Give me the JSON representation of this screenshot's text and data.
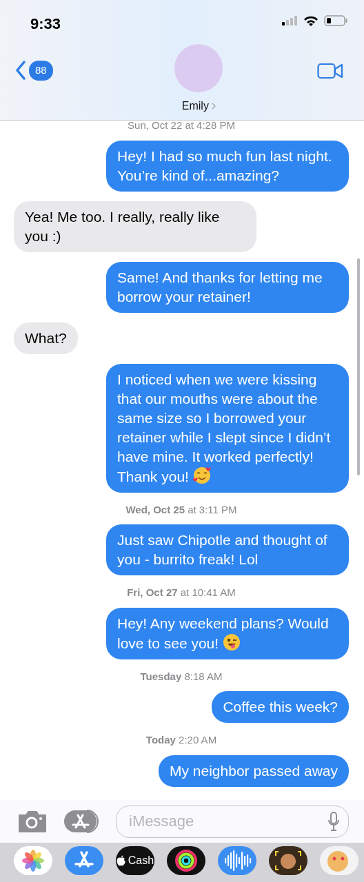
{
  "status_bar": {
    "time": "9:33"
  },
  "header": {
    "back_badge": "88",
    "contact_name": "Emily"
  },
  "messages": [
    {
      "kind": "timestamp",
      "text": "Sun, Oct 22 at 4:28 PM"
    },
    {
      "kind": "sent",
      "text": "Hey! I had so much fun last night. You’re kind of...amazing?"
    },
    {
      "kind": "received",
      "text": "Yea! Me too. I really, really like you :)"
    },
    {
      "kind": "sent",
      "text": "Same! And thanks for letting me borrow your retainer!"
    },
    {
      "kind": "received",
      "text": "What?"
    },
    {
      "kind": "sent",
      "text": "I noticed when we were kissing that our mouths were about the same size so I borrowed your retainer while I slept since I didn’t have mine. It worked perfectly! Thank you!",
      "emoji": {
        "kind": "hearts"
      }
    },
    {
      "kind": "timestamp",
      "text": "**Wed, Oct 25** at 3:11 PM"
    },
    {
      "kind": "sent",
      "text": "Just saw Chipotle and thought of you - burrito freak! Lol"
    },
    {
      "kind": "timestamp",
      "text": "**Fri, Oct 27** at 10:41 AM"
    },
    {
      "kind": "sent",
      "text": "Hey! Any weekend plans? Would love to see you!",
      "emoji": {
        "kind": "wink"
      }
    },
    {
      "kind": "timestamp",
      "text": "**Tuesday** 8:18 AM"
    },
    {
      "kind": "sent",
      "text": "Coffee this week?"
    },
    {
      "kind": "timestamp",
      "text": "**Today** 2:20 AM"
    },
    {
      "kind": "sent",
      "text": "My neighbor passed away"
    }
  ],
  "composer": {
    "placeholder": "iMessage"
  },
  "app_drawer": [
    {
      "kind": "photos"
    },
    {
      "kind": "appstore"
    },
    {
      "kind": "cash",
      "label": "Cash"
    },
    {
      "kind": "activity"
    },
    {
      "kind": "audio"
    },
    {
      "kind": "memoji"
    },
    {
      "kind": "stickers"
    }
  ]
}
